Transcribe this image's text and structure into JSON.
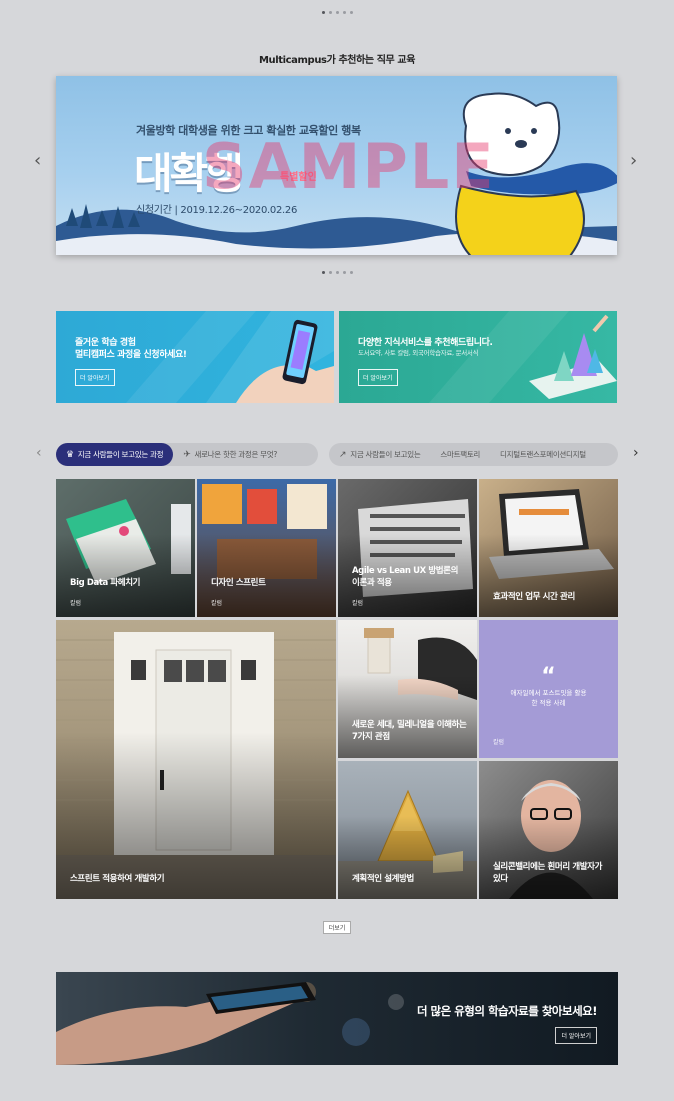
{
  "section_title": "Multicampus가 추천하는 직무 교육",
  "hero": {
    "subtitle": "겨울방학 대학생을 위한 크고 확실한 교육할인 행복",
    "big_text": "대확행",
    "percent_text": "특별할인",
    "period": "신청기간 | 2019.12.26~2020.02.26",
    "watermark": "SAMPLE",
    "prev": "‹",
    "next": "›"
  },
  "promos": [
    {
      "line1": "즐거운 학습 경험",
      "line2": "멀티캠퍼스 과정을 신청하세요!",
      "button": "더 알아보기",
      "color": "#2ea9d6"
    },
    {
      "line1": "다양한 지식서비스를 추천해드립니다.",
      "line2": "도서요약, 사토 칼럼, 외국어학습자료, 문서서식",
      "button": "더 알아보기",
      "color": "#2ba894"
    }
  ],
  "tabs": {
    "prev": "‹",
    "next": "›",
    "group_a": [
      {
        "label": "지금 사람들이 보고있는 과정",
        "icon": "crown-icon"
      },
      {
        "label": "새로나온 핫한 과정은 무엇?",
        "icon": "megaphone-icon"
      }
    ],
    "group_b": [
      {
        "label": "지금 사람들이 보고있는",
        "icon": "trend-icon"
      },
      {
        "label": "스마트팩토리"
      },
      {
        "label": "디지털트랜스포메이션디지털"
      }
    ]
  },
  "cards": [
    {
      "title": "Big Data 파헤치기",
      "tag": "칼럼"
    },
    {
      "title": "디자인 스프린트",
      "tag": "칼럼"
    },
    {
      "title": "Agile vs Lean UX 방법론의 이론과 적용",
      "tag": "칼럼"
    },
    {
      "title": "효과적인 업무 시간 관리",
      "tag": ""
    },
    {
      "title": "스프린트 적용하여 개발하기",
      "tag": ""
    },
    {
      "title": "새로운 세대, 밀레니얼을 이해하는 7가지 관점",
      "tag": ""
    },
    {
      "title": "애자일에서 포스트잇을 활용한 적용 사례",
      "tag": "칼럼",
      "quote": "“"
    },
    {
      "title": "계획적인 설계방법",
      "tag": ""
    },
    {
      "title": "실리콘밸리에는 흰머리 개발자가 있다",
      "tag": ""
    }
  ],
  "more_button": "더보기",
  "bottom_banner": {
    "title": "더 많은 유형의 학습자료를 찾아보세요!",
    "button": "더 알아보기"
  }
}
